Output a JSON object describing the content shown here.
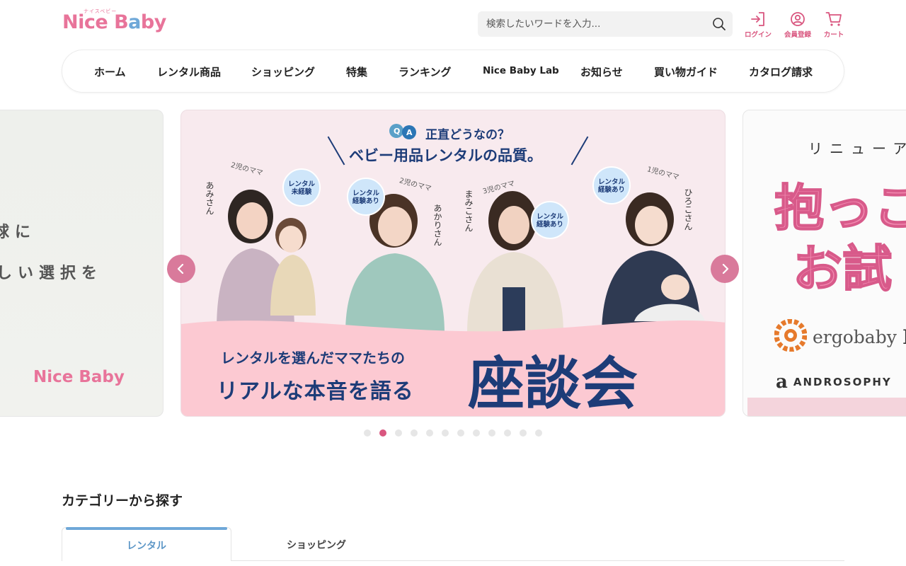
{
  "header": {
    "logo": {
      "main_left": "Nice",
      "main_right_1": "B",
      "main_right_2": "a",
      "main_right_3": "by",
      "kana": "ナイスベビー"
    },
    "search": {
      "placeholder": "検索したいワードを入力..."
    },
    "icons": [
      {
        "label": "ログイン",
        "icon": "login-icon"
      },
      {
        "label": "会員登録",
        "icon": "user-icon"
      },
      {
        "label": "カート",
        "icon": "cart-icon"
      }
    ]
  },
  "nav": {
    "items": [
      "ホーム",
      "レンタル商品",
      "ショッピング",
      "特集",
      "ランキング",
      "Nice Baby Lab",
      "お知らせ",
      "買い物ガイド",
      "カタログ請求"
    ]
  },
  "carousel": {
    "left_slide": {
      "line1": "球に",
      "line2": "しい選択を",
      "logo": "Nice Baby"
    },
    "main_slide": {
      "qa": "QA",
      "title1": "正直どうなの？",
      "title2": "ベビー用品レンタルの品質。",
      "subtitle1": "レンタルを選んだママたちの",
      "subtitle2": "リアルな本音を語る",
      "big": "座談会",
      "people": [
        {
          "caption": "2児のママ",
          "name": "あみさん",
          "bubble": "レンタル\n未経験"
        },
        {
          "caption": "2児のママ",
          "name": "あかりさん",
          "bubble": "レンタル\n経験あり"
        },
        {
          "caption": "3児のママ",
          "name": "まみこさん",
          "bubble": "レンタル\n経験あり"
        },
        {
          "caption": "1児のママ",
          "name": "ひろこさん",
          "bubble": "レンタル\n経験あり"
        }
      ]
    },
    "right_slide": {
      "top": "リニューア",
      "big1": "抱っこ",
      "big2": "お試",
      "brand1": "ergobaby",
      "brand1b": "Ba",
      "brand2_mark": "a",
      "brand2": "ANDROSOPHY"
    },
    "dots_total": 12,
    "active_dot": 1
  },
  "category": {
    "title": "カテゴリーから探す",
    "tabs": [
      "レンタル",
      "ショッピング"
    ]
  }
}
